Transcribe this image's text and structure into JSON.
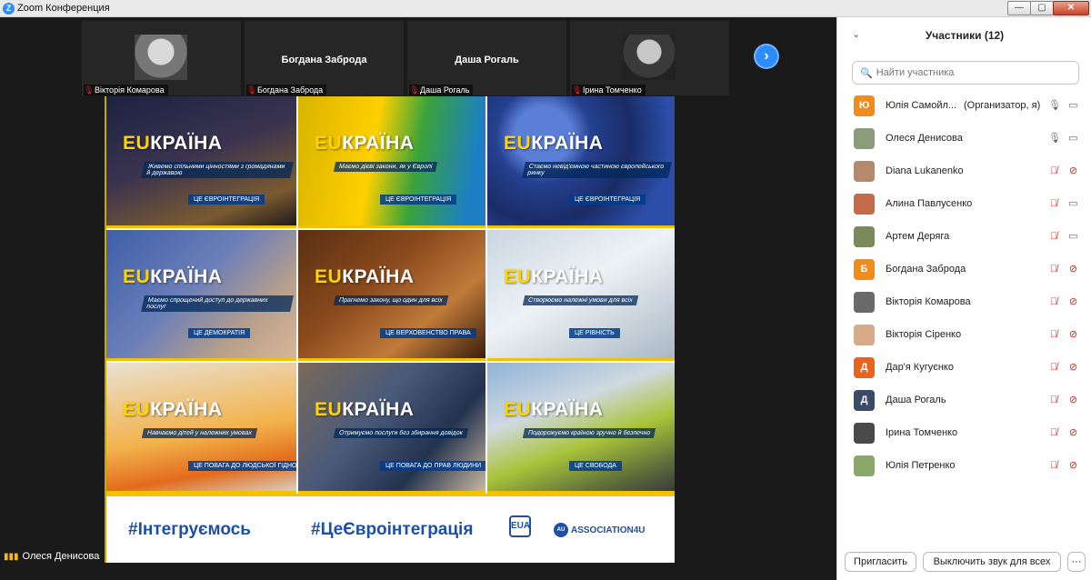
{
  "window": {
    "title": "Zoom Конференция",
    "app_icon": "Z",
    "buttons": {
      "minimize": "—",
      "maximize": "▢",
      "close": "✕"
    }
  },
  "thumbnails": [
    {
      "name": "Вікторія Комарова",
      "display_name": "",
      "has_video": true
    },
    {
      "name": "Богдана Заброда",
      "display_name": "Богдана Заброда",
      "has_video": false
    },
    {
      "name": "Даша Рогаль",
      "display_name": "Даша Рогаль",
      "has_video": false
    },
    {
      "name": "Ірина Томченко",
      "display_name": "",
      "has_video": true
    }
  ],
  "next_icon": "›",
  "shared": {
    "tiles": [
      {
        "logo_a": "EU",
        "logo_b": "КРАЇНА",
        "slogan": "Живемо спільними цінностями з громадянами й державою",
        "tag": "ЦЕ ЄВРОІНТЕГРАЦІЯ",
        "bg": "linear-gradient(160deg,#1b2340 0%,#3a3350 45%,#7a5a30 80%,#201a18 100%)"
      },
      {
        "logo_a": "EU",
        "logo_b": "КРАЇНА",
        "slogan": "Маємо дієві закони, як у Європі",
        "tag": "ЦЕ ЄВРОІНТЕГРАЦІЯ",
        "bg": "linear-gradient(100deg,#d8b400 0%,#ffd000 40%,#3aa33a 62%,#1c7fc4 90%)"
      },
      {
        "logo_a": "EU",
        "logo_b": "КРАЇНА",
        "slogan": "Стаємо невід'ємною частиною європейського ринку",
        "tag": "ЦЕ ЄВРОІНТЕГРАЦІЯ",
        "bg": "radial-gradient(circle at 30% 30%,#5b7fd6 0 18%,#24408f 30%,#1a2c66 55%,#2b4ea8 80%)"
      },
      {
        "logo_a": "EU",
        "logo_b": "КРАЇНА",
        "slogan": "Маємо спрощений доступ до державних послуг",
        "tag": "ЦЕ ДЕМОКРАТІЯ",
        "bg": "linear-gradient(135deg,#3d5fa8 0%,#6c7fb8 45%,#b9a08a 75%,#d8b696 100%)"
      },
      {
        "logo_a": "EU",
        "logo_b": "КРАЇНА",
        "slogan": "Прагнемо закону, що один для всіх",
        "tag": "ЦЕ ВЕРХОВЕНСТВО ПРАВА",
        "bg": "linear-gradient(140deg,#5a2f12 0%,#8a4a1c 40%,#c07a3a 70%,#3a1e0c 100%)"
      },
      {
        "logo_a": "EU",
        "logo_b": "КРАЇНА",
        "slogan": "Створюємо належні умови для всіх",
        "tag": "ЦЕ РІВНІСТЬ",
        "bg": "linear-gradient(150deg,#c9d6e2 0%,#eef2f5 45%,#a9b8c6 100%)"
      },
      {
        "logo_a": "EU",
        "logo_b": "КРАЇНА",
        "slogan": "Навчаємо дітей у належних умовах",
        "tag": "ЦЕ ПОВАГА ДО ЛЮДСЬКОЇ ГІДНОСТІ",
        "bg": "linear-gradient(170deg,#e9e1d2 0%,#f3b24a 55%,#e26b1c 80%,#d9cfc0 100%)"
      },
      {
        "logo_a": "EU",
        "logo_b": "КРАЇНА",
        "slogan": "Отримуємо послуги без збирання довідок",
        "tag": "ЦЕ ПОВАГА ДО ПРАВ ЛЮДИНИ",
        "bg": "linear-gradient(130deg,#7a6a5a 0%,#4a5a7a 40%,#22324f 70%,#c8b8a0 100%)"
      },
      {
        "logo_a": "EU",
        "logo_b": "КРАЇНА",
        "slogan": "Подорожуємо країною зручно й безпечно",
        "tag": "ЦЕ СВОБОДА",
        "bg": "linear-gradient(160deg,#8fb3d8 0%,#cfd9e0 35%,#a9c43a 60%,#5b6b3a 85%,#3a3a3a 100%)"
      }
    ],
    "footer": {
      "hashtag_1": "#Інтегруємось",
      "hashtag_2": "#ЦеЄвроінтеграція",
      "eu_mark": "EUA",
      "assoc_circle": "AU",
      "assoc_text": "ASSOCIATION4U"
    }
  },
  "active_speaker": {
    "name": "Олеся Денисова",
    "icon": "signal-bars-icon"
  },
  "panel": {
    "title": "Участники (12)",
    "chevron": "⌄",
    "search_placeholder": "Найти участника",
    "participants": [
      {
        "name": "Юлія Самойл...",
        "role": "(Организатор, я)",
        "avatar": "Ю",
        "avatar_color": "#f28b18",
        "mic": "on",
        "cam": "on"
      },
      {
        "name": "Олеся Денисова",
        "role": "",
        "avatar": "",
        "avatar_color": "#8a9c7a",
        "mic": "on",
        "cam": "on"
      },
      {
        "name": "Diana Lukanenko",
        "role": "",
        "avatar": "",
        "avatar_color": "#b58a6a",
        "mic": "off",
        "cam": "off"
      },
      {
        "name": "Алина Павлусенко",
        "role": "",
        "avatar": "",
        "avatar_color": "#c46a4a",
        "mic": "off",
        "cam": "on"
      },
      {
        "name": "Артем Деряга",
        "role": "",
        "avatar": "",
        "avatar_color": "#7a8a5a",
        "mic": "off",
        "cam": "on"
      },
      {
        "name": "Богдана Заброда",
        "role": "",
        "avatar": "Б",
        "avatar_color": "#f28b18",
        "mic": "off",
        "cam": "off"
      },
      {
        "name": "Вікторія Комарова",
        "role": "",
        "avatar": "",
        "avatar_color": "#6a6a6a",
        "mic": "off",
        "cam": "off"
      },
      {
        "name": "Вікторія Сіренко",
        "role": "",
        "avatar": "",
        "avatar_color": "#d9a98a",
        "mic": "off",
        "cam": "off"
      },
      {
        "name": "Дар'я Кугуєнко",
        "role": "",
        "avatar": "Д",
        "avatar_color": "#e8641c",
        "mic": "off",
        "cam": "off"
      },
      {
        "name": "Даша Рогаль",
        "role": "",
        "avatar": "Д",
        "avatar_color": "#3a4a6a",
        "mic": "off",
        "cam": "off"
      },
      {
        "name": "Ірина Томченко",
        "role": "",
        "avatar": "",
        "avatar_color": "#4a4a4a",
        "mic": "off",
        "cam": "off"
      },
      {
        "name": "Юлія Петренко",
        "role": "",
        "avatar": "",
        "avatar_color": "#8aa86a",
        "mic": "off",
        "cam": "off"
      }
    ],
    "buttons": {
      "invite": "Пригласить",
      "mute_all": "Выключить звук для всех",
      "more": "···"
    }
  }
}
